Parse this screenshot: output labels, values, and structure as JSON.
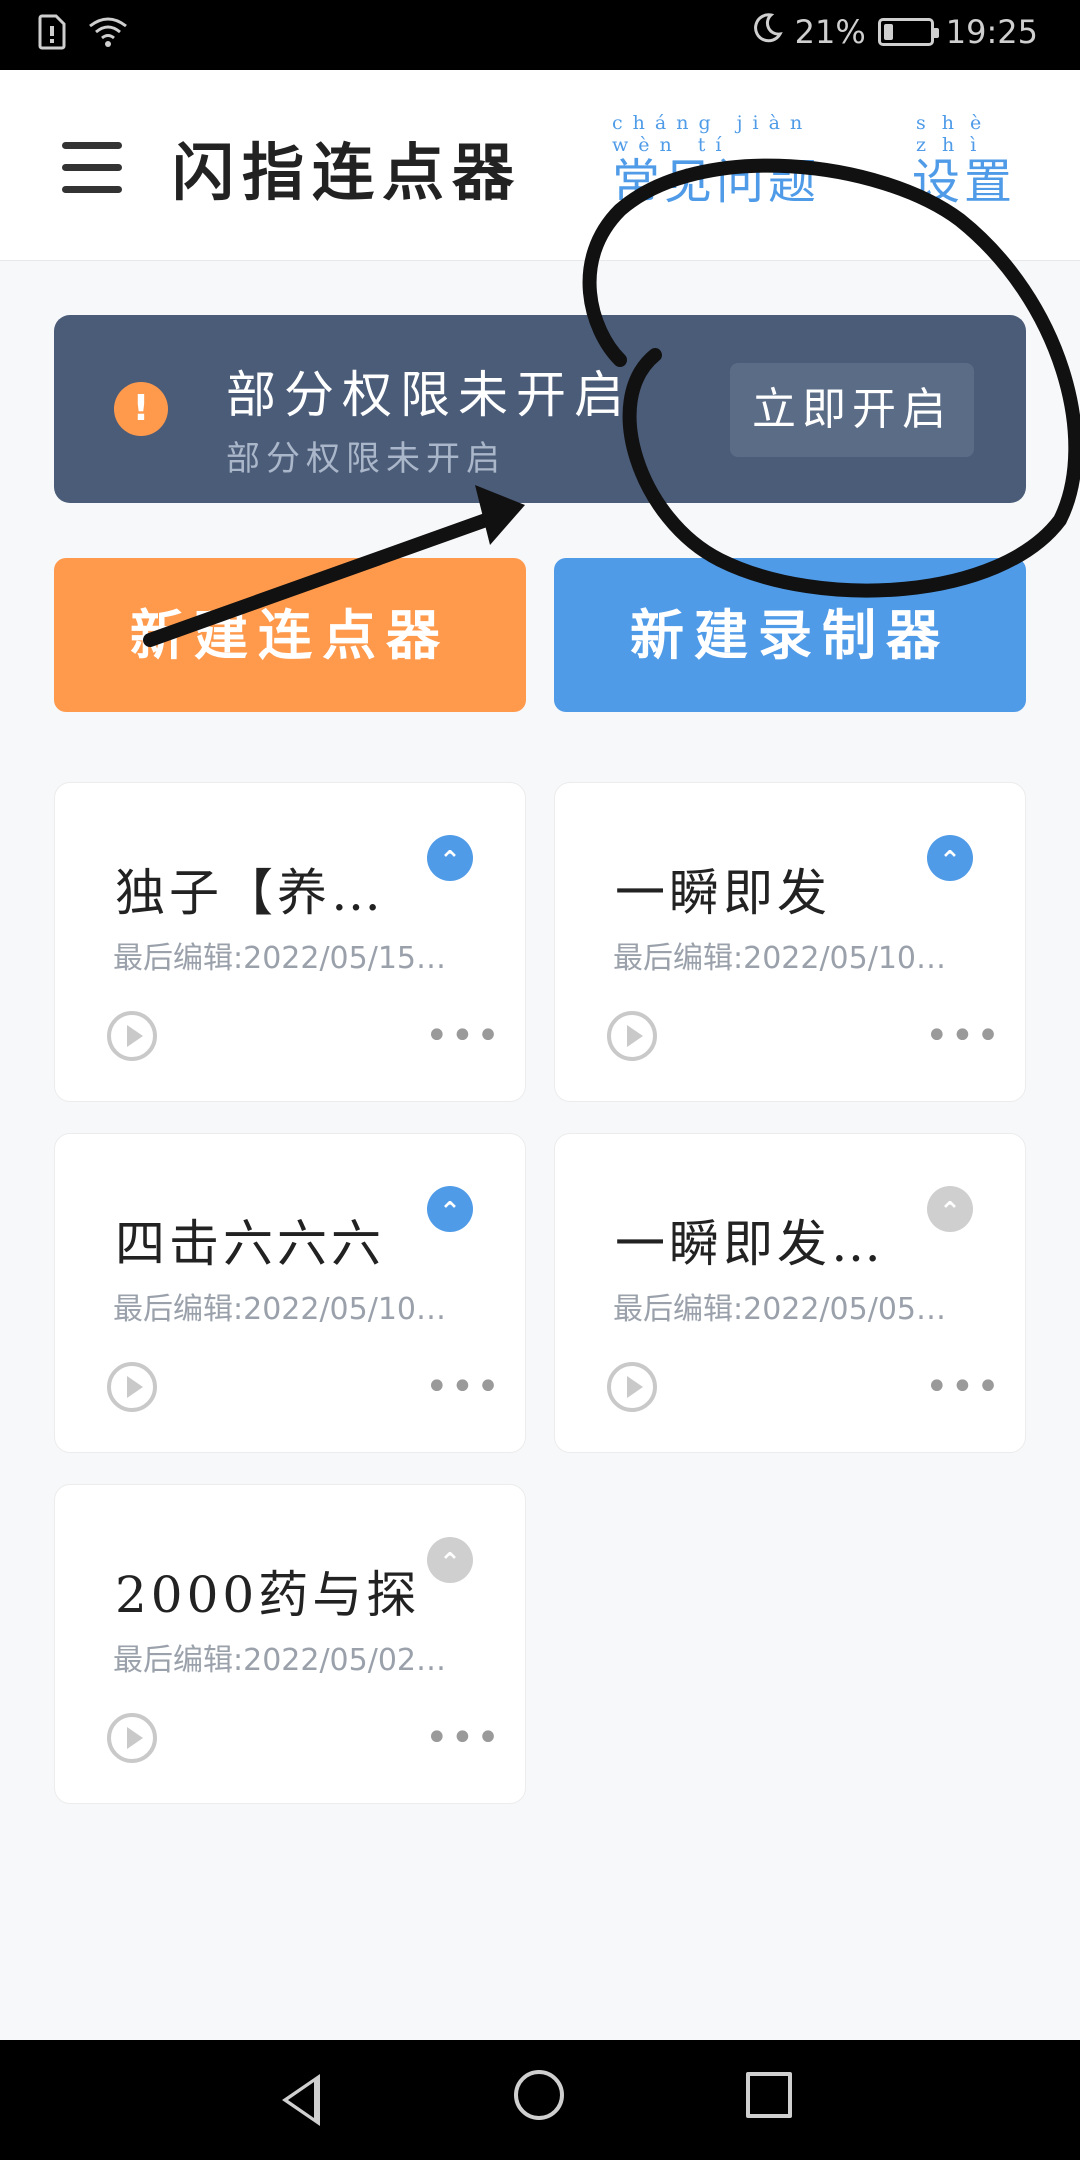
{
  "status_bar": {
    "battery_percent": "21%",
    "battery_level": 0.21,
    "time": "19:25"
  },
  "header": {
    "title": "闪指连点器",
    "faq_label": "常见问题",
    "faq_pinyin": "cháng jiàn wèn tí",
    "settings_label": "设置",
    "settings_pinyin": "shè zhì"
  },
  "banner": {
    "title": "部分权限未开启",
    "subtitle": "部分权限未开启",
    "button_label": "立即开启"
  },
  "actions": {
    "new_clicker": "新建连点器",
    "new_recorder": "新建录制器"
  },
  "cards": [
    {
      "title": "独子【养…",
      "date": "最后编辑:2022/05/15…",
      "pinned": true
    },
    {
      "title": "一瞬即发",
      "date": "最后编辑:2022/05/10…",
      "pinned": true
    },
    {
      "title": "四击六六六",
      "date": "最后编辑:2022/05/10…",
      "pinned": true
    },
    {
      "title": "一瞬即发…",
      "date": "最后编辑:2022/05/05…",
      "pinned": false
    },
    {
      "title": "2000药与探",
      "date": "最后编辑:2022/05/02…",
      "pinned": false
    }
  ],
  "icons": {
    "menu": "hamburger-icon",
    "warning": "exclamation-icon",
    "pin": "pin-top-icon",
    "play": "play-icon",
    "more": "more-dots-icon"
  },
  "colors": {
    "accent_blue": "#4f9be8",
    "accent_orange": "#ff9a4d",
    "banner_bg": "#4b5c78"
  }
}
